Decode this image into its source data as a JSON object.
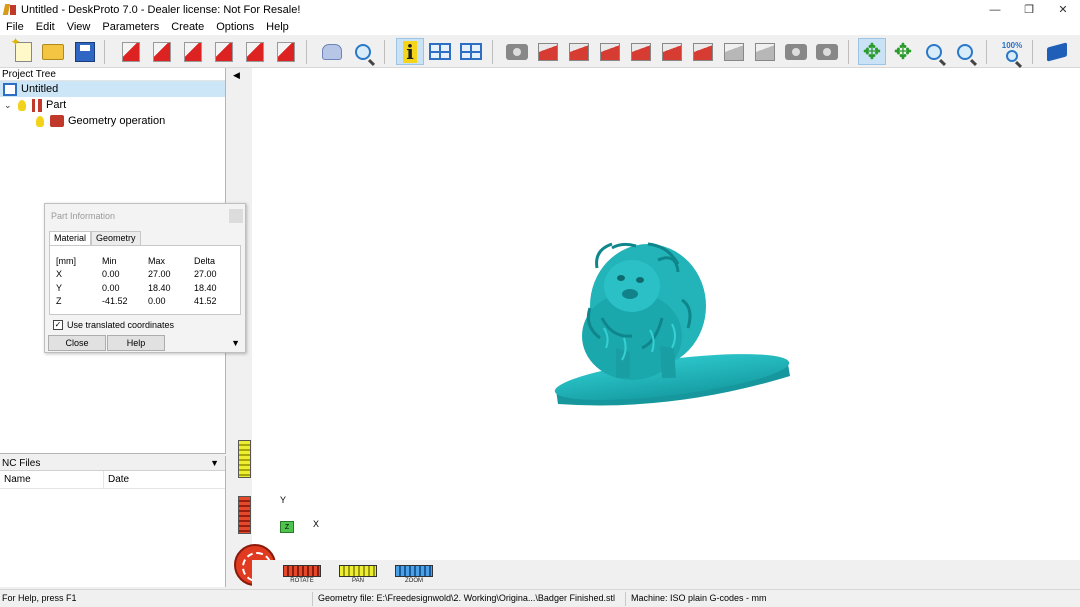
{
  "window": {
    "title": "Untitled - DeskProto 7.0 - Dealer license: Not For Resale!",
    "controls": [
      "—",
      "❐",
      "✕"
    ]
  },
  "menu": [
    "File",
    "Edit",
    "View",
    "Parameters",
    "Create",
    "Options",
    "Help"
  ],
  "toolbar": {
    "zoom_100_label": "100%",
    "buttons": [
      "new-icon",
      "open-folder-icon",
      "save-icon",
      "part-params-icon",
      "operation-icon",
      "material-icon",
      "tool-icon",
      "drawing-icon",
      "export-icon",
      "shape-icon",
      "search-shape-icon",
      "info-icon",
      "window-icon",
      "screen-icon",
      "camera-icon",
      "view-front-icon",
      "view-back-icon",
      "view-left-icon",
      "view-right-icon",
      "view-top-icon",
      "view-bottom-icon",
      "view-iso-icon",
      "view-custom-icon",
      "camera-red-icon",
      "camera-grey-icon",
      "rotate-arrows-icon",
      "pan-arrows-icon",
      "zoom-in-icon",
      "zoom-window-icon",
      "zoom-100-icon",
      "book-icon"
    ],
    "active": "info-icon"
  },
  "project_tree": {
    "header": "Project Tree",
    "items": [
      {
        "label": "Untitled",
        "level": 0,
        "selected": true
      },
      {
        "label": "Part",
        "level": 1,
        "selected": false
      },
      {
        "label": "Geometry operation",
        "level": 2,
        "selected": false
      }
    ]
  },
  "part_info": {
    "title": "Part Information",
    "tabs": [
      "Material",
      "Geometry"
    ],
    "active_tab": "Material",
    "headers": [
      "[mm]",
      "Min",
      "Max",
      "Delta"
    ],
    "rows": [
      [
        "X",
        "0.00",
        "27.00",
        "27.00"
      ],
      [
        "Y",
        "0.00",
        "18.40",
        "18.40"
      ],
      [
        "Z",
        "-41.52",
        "0.00",
        "41.52"
      ]
    ],
    "checkbox_label": "Use translated coordinates",
    "checkbox_checked": true,
    "close_label": "Close",
    "help_label": "Help"
  },
  "nc_files": {
    "header": "NC Files",
    "columns": [
      "Name",
      "Date"
    ]
  },
  "viewport": {
    "axis_y": "Y",
    "axis_x": "X",
    "axis_z": "Z",
    "model_color": "#1fb3b8",
    "controls": [
      "ROTATE",
      "PAN",
      "ZOOM"
    ]
  },
  "status": {
    "help": "For Help, press F1",
    "geometry_file": "Geometry file: E:\\Freedesignwold\\2. Working\\Origina...\\Badger Finished.stl",
    "machine": "Machine: ISO plain G-codes - mm"
  }
}
